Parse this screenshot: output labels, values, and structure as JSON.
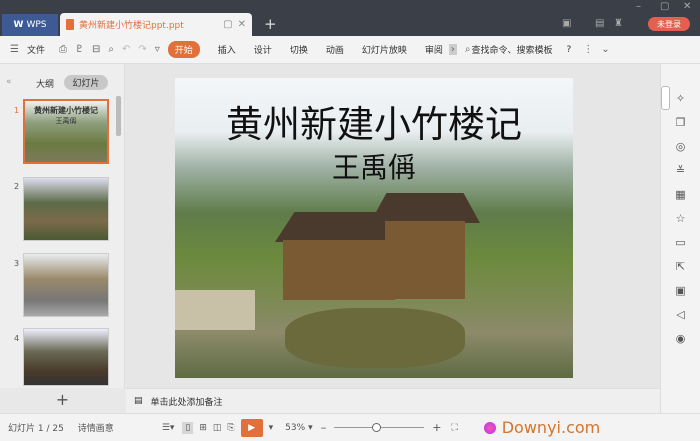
{
  "titlebar": {
    "app_tab": "WPS",
    "doc_title": "黄州新建小竹楼记ppt.ppt",
    "login": "未登录"
  },
  "toolbar": {
    "file": "文件",
    "start": "开始",
    "tabs": [
      "插入",
      "设计",
      "切换",
      "动画",
      "幻灯片放映",
      "审阅"
    ],
    "search": "查找命令、搜索模板",
    "help": "?"
  },
  "left_panel": {
    "tabs": [
      "大纲",
      "幻灯片"
    ],
    "slide_numbers": [
      "1",
      "2",
      "3",
      "4"
    ],
    "thumb1_title": "黄州新建小竹楼记",
    "thumb1_sub": "王禹偁"
  },
  "slide": {
    "title": "黄州新建小竹楼记",
    "subtitle": "王禹偁"
  },
  "notes": {
    "placeholder": "单击此处添加备注"
  },
  "status": {
    "slide_counter": "幻灯片 1 / 25",
    "theme": "诗情画意",
    "zoom": "53%",
    "watermark": "Downyi.com"
  }
}
